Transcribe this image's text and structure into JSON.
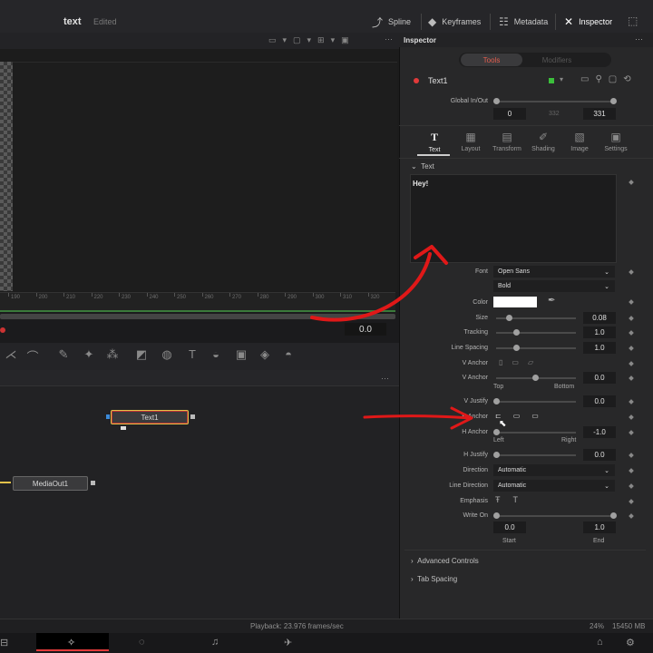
{
  "header": {
    "title": "text",
    "status": "Edited",
    "spline": "Spline",
    "keyframes": "Keyframes",
    "metadata": "Metadata",
    "inspector": "Inspector"
  },
  "viewer": {
    "ticks": [
      "190",
      "200",
      "210",
      "220",
      "230",
      "240",
      "250",
      "260",
      "270",
      "280",
      "290",
      "300",
      "310",
      "320"
    ],
    "value": "0.0"
  },
  "nodes": {
    "text1": "Text1",
    "mediaout": "MediaOut1"
  },
  "inspector": {
    "title": "Inspector",
    "tab_tools": "Tools",
    "tab_modifiers": "Modifiers",
    "tool_name": "Text1",
    "global_inout": "Global In/Out",
    "global_start": "0",
    "global_mid": "332",
    "global_end": "331",
    "subtabs": [
      "Text",
      "Layout",
      "Transform",
      "Shading",
      "Image",
      "Settings"
    ],
    "section_text": "Text",
    "text_value": "Hey!",
    "font_label": "Font",
    "font_value": "Open Sans",
    "style_value": "Bold",
    "color_label": "Color",
    "size_label": "Size",
    "size_value": "0.08",
    "tracking_label": "Tracking",
    "tracking_value": "1.0",
    "linespacing_label": "Line Spacing",
    "linespacing_value": "1.0",
    "vanchor_label": "V Anchor",
    "vanchor2_label": "V Anchor",
    "vanchor2_value": "0.0",
    "top": "Top",
    "bottom": "Bottom",
    "vjustify_label": "V Justify",
    "vjustify_value": "0.0",
    "hanchor_label": "H Anchor",
    "hanchor2_label": "H Anchor",
    "hanchor2_value": "-1.0",
    "left": "Left",
    "right": "Right",
    "hjustify_label": "H Justify",
    "hjustify_value": "0.0",
    "direction_label": "Direction",
    "direction_value": "Automatic",
    "linedirection_label": "Line Direction",
    "linedirection_value": "Automatic",
    "emphasis_label": "Emphasis",
    "writeon_label": "Write On",
    "writeon_start": "0.0",
    "writeon_end": "1.0",
    "start": "Start",
    "end": "End",
    "advanced": "Advanced Controls",
    "tabspacing": "Tab Spacing"
  },
  "status": {
    "playback": "Playback: 23.976 frames/sec",
    "zoom": "24%",
    "memory": "15450 MB"
  },
  "colors": {
    "accent_red": "#e23a3a",
    "node_highlight": "#e2c24a",
    "annotation": "#e01818"
  }
}
